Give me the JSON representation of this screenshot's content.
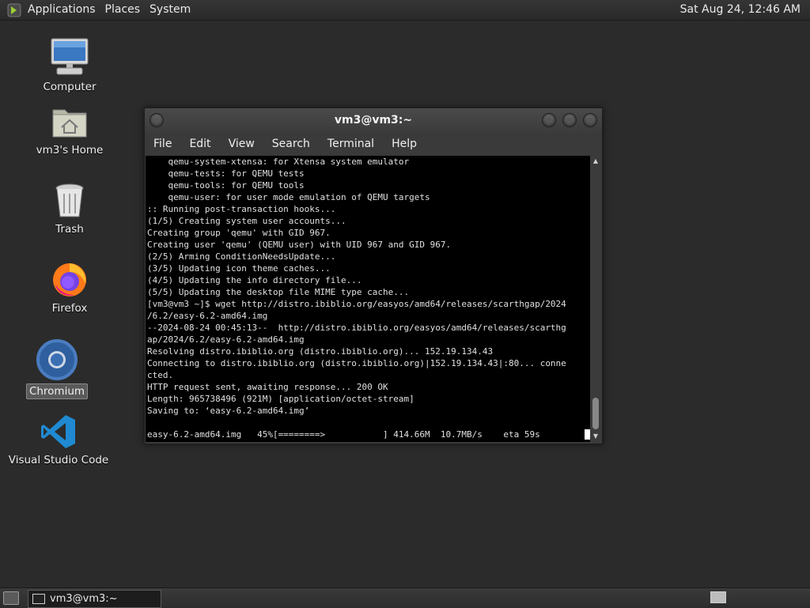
{
  "top_panel": {
    "menus": [
      "Applications",
      "Places",
      "System"
    ],
    "clock": "Sat Aug 24, 12:46 AM"
  },
  "desktop": {
    "icons": [
      {
        "label": "Computer",
        "icon": "computer-icon"
      },
      {
        "label": "vm3's Home",
        "icon": "home-folder-icon"
      },
      {
        "label": "Trash",
        "icon": "trash-icon"
      },
      {
        "label": "Firefox",
        "icon": "firefox-icon"
      },
      {
        "label": "Chromium",
        "icon": "chromium-icon",
        "selected": true
      },
      {
        "label": "Visual Studio Code",
        "icon": "vscode-icon"
      }
    ]
  },
  "terminal": {
    "title": "vm3@vm3:~",
    "menu": [
      "File",
      "Edit",
      "View",
      "Search",
      "Terminal",
      "Help"
    ],
    "lines": [
      "    qemu-system-xtensa: for Xtensa system emulator",
      "    qemu-tests: for QEMU tests",
      "    qemu-tools: for QEMU tools",
      "    qemu-user: for user mode emulation of QEMU targets",
      ":: Running post-transaction hooks...",
      "(1/5) Creating system user accounts...",
      "Creating group 'qemu' with GID 967.",
      "Creating user 'qemu' (QEMU user) with UID 967 and GID 967.",
      "(2/5) Arming ConditionNeedsUpdate...",
      "(3/5) Updating icon theme caches...",
      "(4/5) Updating the info directory file...",
      "(5/5) Updating the desktop file MIME type cache...",
      "[vm3@vm3 ~]$ wget http://distro.ibiblio.org/easyos/amd64/releases/scarthgap/2024",
      "/6.2/easy-6.2-amd64.img",
      "--2024-08-24 00:45:13--  http://distro.ibiblio.org/easyos/amd64/releases/scarthg",
      "ap/2024/6.2/easy-6.2-amd64.img",
      "Resolving distro.ibiblio.org (distro.ibiblio.org)... 152.19.134.43",
      "Connecting to distro.ibiblio.org (distro.ibiblio.org)|152.19.134.43|:80... conne",
      "cted.",
      "HTTP request sent, awaiting response... 200 OK",
      "Length: 965738496 (921M) [application/octet-stream]",
      "Saving to: ‘easy-6.2-amd64.img’"
    ],
    "status_line": "easy-6.2-amd64.img   45%[========>           ] 414.66M  10.7MB/s    eta 59s"
  },
  "taskbar": {
    "task_label": "vm3@vm3:~"
  }
}
